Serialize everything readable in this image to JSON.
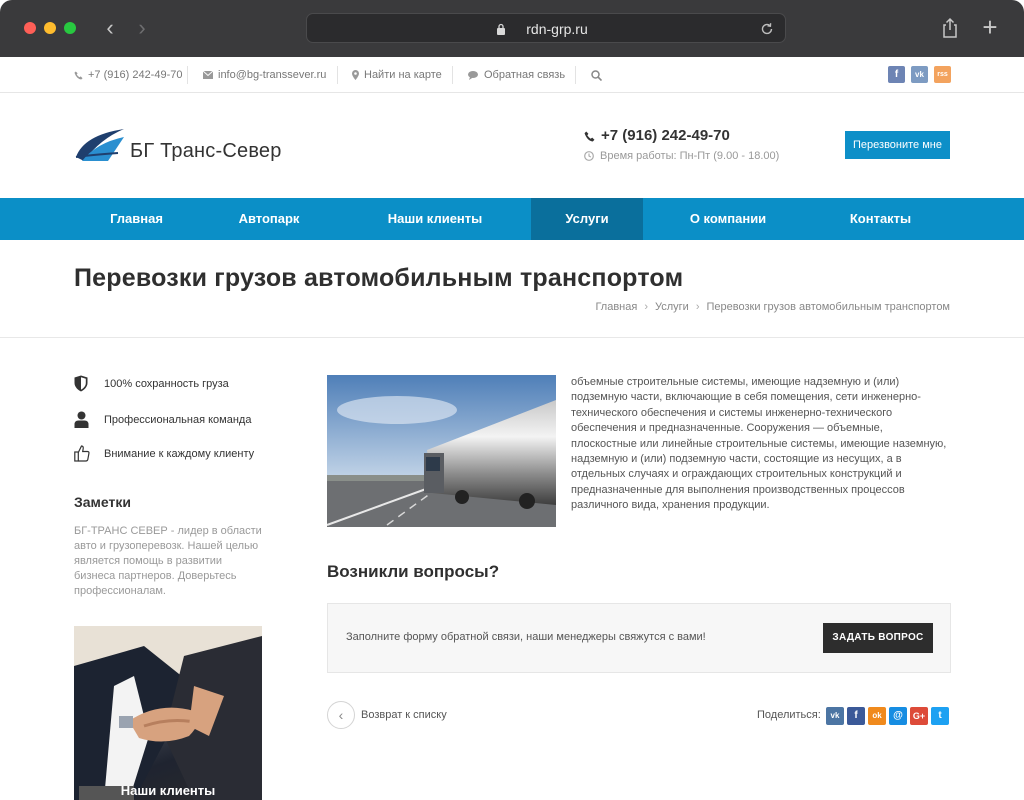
{
  "browser": {
    "url": "rdn-grp.ru"
  },
  "topbar": {
    "phone": "+7 (916) 242-49-70",
    "email": "info@bg-transsever.ru",
    "map": "Найти на карте",
    "feedback": "Обратная связь",
    "social": [
      {
        "name": "facebook",
        "glyph": "f",
        "color": "#6d84b4"
      },
      {
        "name": "vkontakte",
        "glyph": "vk",
        "color": "#7d9bc2"
      },
      {
        "name": "rss",
        "glyph": "rss",
        "color": "#f3a35e"
      }
    ]
  },
  "header": {
    "logo_text": "БГ Транс-Север",
    "phone": "+7 (916) 242-49-70",
    "hours": "Время работы: Пн-Пт (9.00 - 18.00)",
    "callback_button": "Перезвоните мне"
  },
  "nav": {
    "items": [
      {
        "label": "Главная",
        "active": false
      },
      {
        "label": "Автопарк",
        "active": false
      },
      {
        "label": "Наши клиенты",
        "active": false
      },
      {
        "label": "Услуги",
        "active": true
      },
      {
        "label": "О компании",
        "active": false
      },
      {
        "label": "Контакты",
        "active": false
      }
    ]
  },
  "page": {
    "title": "Перевозки грузов автомобильным транспортом",
    "breadcrumbs": [
      "Главная",
      "Услуги",
      "Перевозки грузов автомобильным транспортом"
    ]
  },
  "sidebar": {
    "features": [
      {
        "icon": "shield-icon",
        "label": "100% сохранность груза"
      },
      {
        "icon": "user-icon",
        "label": "Профессиональная команда"
      },
      {
        "icon": "thumbs-up-icon",
        "label": "Внимание к каждому клиенту"
      }
    ],
    "notes_title": "Заметки",
    "notes_text": "БГ-ТРАНС СЕВЕР - лидер в области авто и грузоперевозк. Нашей целью является помощь в развитии бизнеса партнеров. Доверьтесь профессионалам.",
    "promo_label": "Наши клиенты"
  },
  "content": {
    "article_text": "объемные строительные системы, имеющие надземную и (или) подземную части, включающие в себя помещения, сети инженерно-технического обеспечения и системы инженерно-технического обеспечения и предназначенные. Сооружения — объемные, плоскостные или линейные строительные системы, имеющие наземную, надземную и (или) подземную части, состоящие из несущих, а в отдельных случаях и ограждающих строительных конструкций и предназначенные для выполнения производственных процессов различного вида, хранения продукции.",
    "questions_title": "Возникли вопросы?",
    "questions_text": "Заполните форму обратной связи, наши менеджеры свяжутся с вами!",
    "ask_button": "ЗАДАТЬ ВОПРОС",
    "back_link": "Возврат к списку",
    "share_label": "Поделиться:",
    "share_icons": [
      {
        "name": "vkontakte",
        "glyph": "vk",
        "color": "#4c75a3"
      },
      {
        "name": "facebook",
        "glyph": "f",
        "color": "#3b5998"
      },
      {
        "name": "odnoklassniki",
        "glyph": "ok",
        "color": "#f08a1d"
      },
      {
        "name": "moimir",
        "glyph": "@",
        "color": "#168de2"
      },
      {
        "name": "googleplus",
        "glyph": "G+",
        "color": "#dd4b39"
      },
      {
        "name": "twitter",
        "glyph": "t",
        "color": "#1da1f2"
      }
    ]
  }
}
